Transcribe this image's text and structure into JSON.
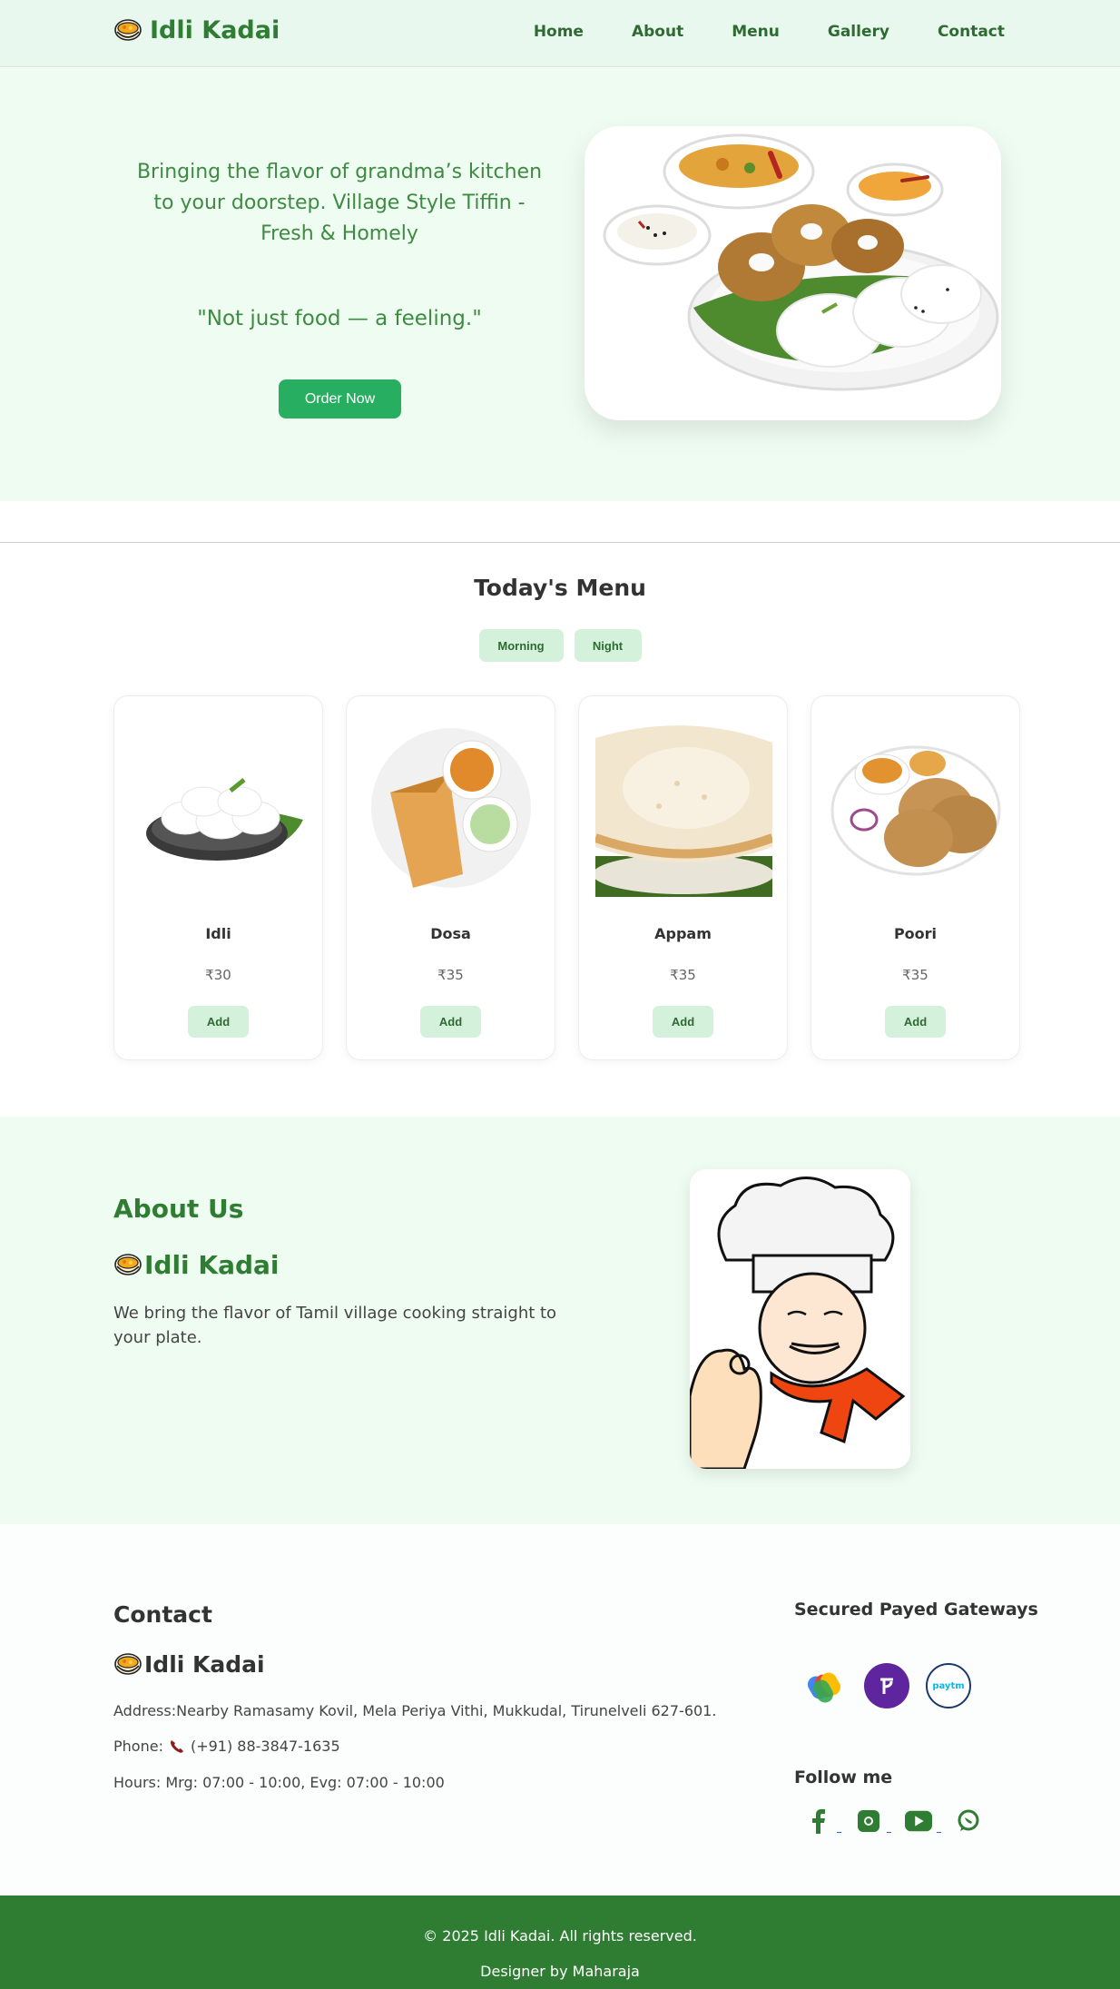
{
  "nav": {
    "brand": "Idli Kadai",
    "links": [
      "Home",
      "About",
      "Menu",
      "Gallery",
      "Contact"
    ]
  },
  "hero": {
    "tagline": "Bringing the flavor of grandma’s kitchen to your doorstep. Village Style Tiffin - Fresh & Homely",
    "quote": "\"Not just food — a feeling.\"",
    "cta": "Order Now"
  },
  "menu": {
    "title": "Today's Menu",
    "tabs": [
      "Morning",
      "Night"
    ],
    "items": [
      {
        "name": "Idli",
        "price": "₹30",
        "action": "Add"
      },
      {
        "name": "Dosa",
        "price": "₹35",
        "action": "Add"
      },
      {
        "name": "Appam",
        "price": "₹35",
        "action": "Add"
      },
      {
        "name": "Poori",
        "price": "₹35",
        "action": "Add"
      }
    ]
  },
  "about": {
    "heading": "About Us",
    "brand": "Idli Kadai",
    "text": "We bring the flavor of Tamil village cooking straight to your plate."
  },
  "contact": {
    "heading": "Contact",
    "brand": "Idli Kadai",
    "address": "Address:Nearby Ramasamy Kovil, Mela Periya Vithi, Mukkudal, Tirunelveli 627-601.",
    "phone_label": "Phone:",
    "phone": "(+91) 88-3847-1635",
    "hours": "Hours: Mrg: 07:00 - 10:00, Evg: 07:00 - 10:00",
    "gateways_heading": "Secured Payed Gateways",
    "paytm_text": "paytm",
    "follow_heading": "Follow me"
  },
  "footer": {
    "copyright": "© 2025 Idli Kadai. All rights reserved.",
    "designer": "Designer by Maharaja"
  },
  "colors": {
    "brand_green": "#2e7d32",
    "cta_green": "#27ae60",
    "tab_bg": "#d4f1dc",
    "hero_bg": "#effcf2"
  },
  "icons": [
    "bowl-icon",
    "phone-icon",
    "google-pay-icon",
    "phonepe-icon",
    "paytm-icon",
    "facebook-icon",
    "instagram-icon",
    "youtube-icon",
    "whatsapp-icon"
  ]
}
